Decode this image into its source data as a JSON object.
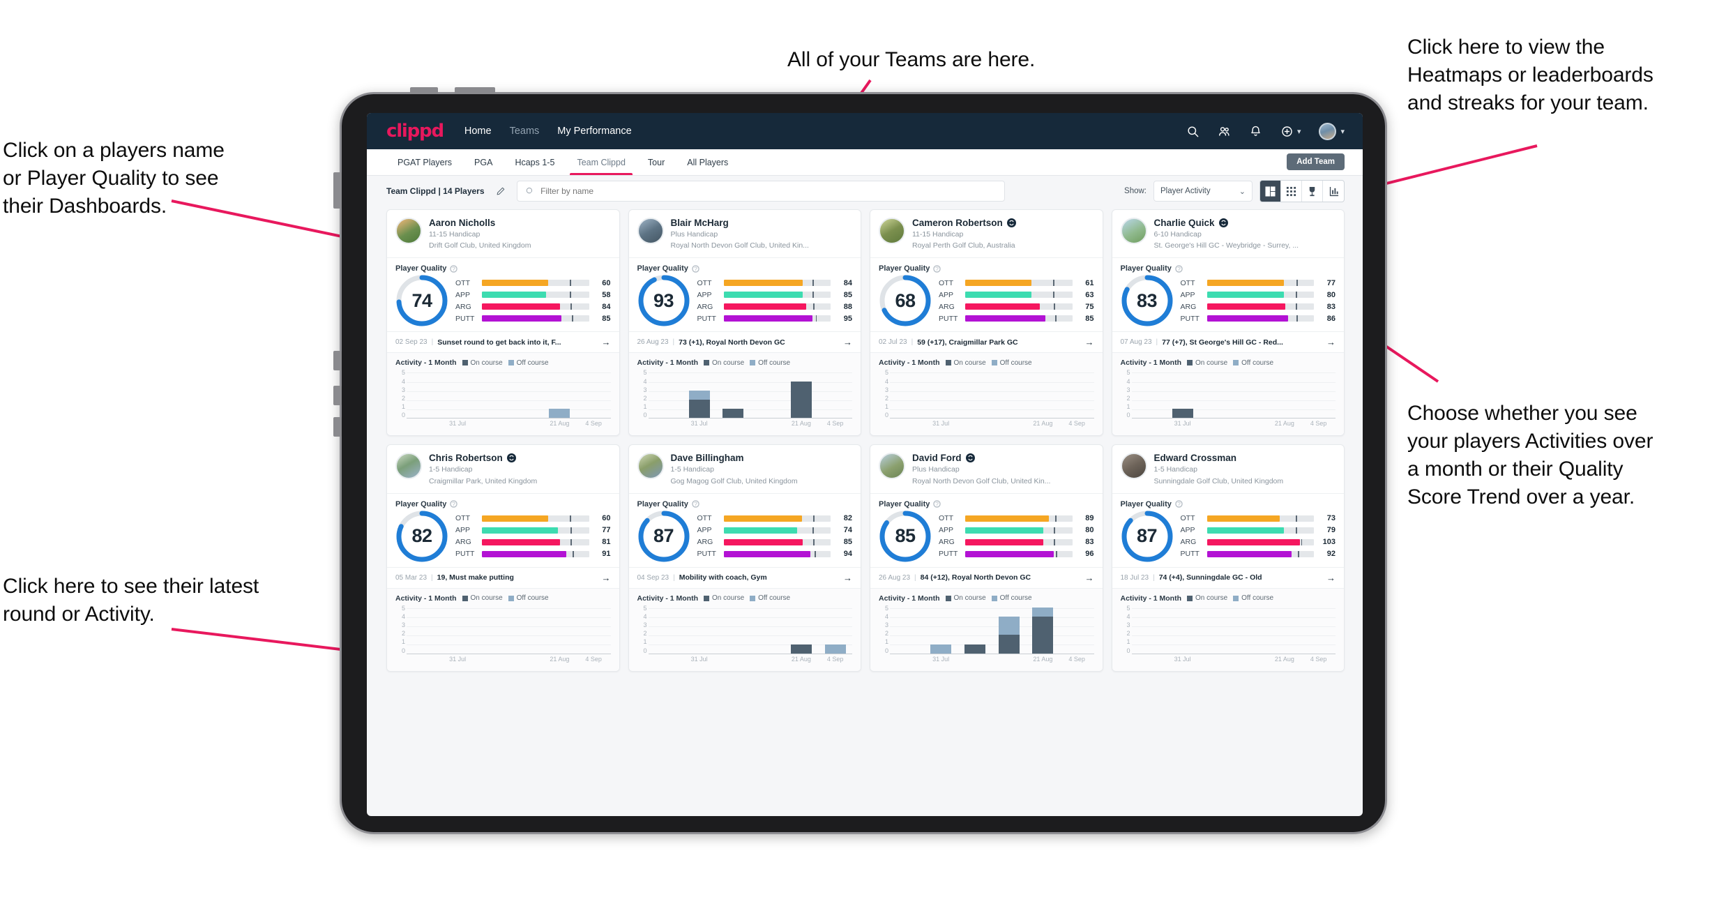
{
  "annotations": [
    {
      "id": "teams-note",
      "text": "All of your Teams are here."
    },
    {
      "id": "heatmaps-note",
      "text": "Click here to view the\nHeatmaps or leaderboards\nand streaks for your team."
    },
    {
      "id": "player-name-note",
      "text": "Click on a players name\nor Player Quality to see\ntheir Dashboards."
    },
    {
      "id": "activity-toggle-note",
      "text": "Choose whether you see\nyour players Activities over\na month or their Quality\nScore Trend over a year."
    },
    {
      "id": "latest-round-note",
      "text": "Click here to see their latest\nround or Activity."
    }
  ],
  "app": {
    "logo": "clippd",
    "nav": [
      {
        "label": "Home",
        "active": true
      },
      {
        "label": "Teams",
        "active": false
      },
      {
        "label": "My Performance",
        "active": true
      }
    ],
    "icons": {
      "search": "search-icon",
      "people": "people-icon",
      "bell": "bell-icon",
      "plus": "plus-circle-icon",
      "avatar": "user-avatar"
    }
  },
  "subnav": {
    "tabs": [
      {
        "label": "PGAT Players",
        "active": false
      },
      {
        "label": "PGA",
        "active": false
      },
      {
        "label": "Hcaps 1-5",
        "active": false
      },
      {
        "label": "Team Clippd",
        "active": true
      },
      {
        "label": "Tour",
        "active": false
      },
      {
        "label": "All Players",
        "active": false
      }
    ],
    "add_team_label": "Add Team"
  },
  "filterbar": {
    "team_label": "Team Clippd | 14 Players",
    "edit_icon": "pencil-icon",
    "search_placeholder": "Filter by name",
    "search_value": "",
    "show_label": "Show:",
    "show_value": "Player Activity",
    "views": [
      {
        "name": "grid-large-view",
        "active": true
      },
      {
        "name": "grid-small-view",
        "active": false
      },
      {
        "name": "trophy-view",
        "active": false
      },
      {
        "name": "streaks-view",
        "active": false
      }
    ]
  },
  "card_labels": {
    "player_quality": "Player Quality",
    "activity_title": "Activity - 1 Month",
    "legend_on": "On course",
    "legend_off": "Off course",
    "round_arrow": "→",
    "metric_names": [
      "OTT",
      "APP",
      "ARG",
      "PUTT"
    ],
    "y_ticks": [
      "5",
      "4",
      "3",
      "2",
      "1",
      "0"
    ],
    "x_ticks": [
      "31 Jul",
      "21 Aug",
      "4 Sep"
    ]
  },
  "colors": {
    "brand_pink": "#e8185d",
    "header_navy": "#16293a",
    "ott": "#f5a623",
    "app": "#3ddcb0",
    "arg": "#f5175f",
    "putt": "#b312d4",
    "ring": "#1f7dd6",
    "ring_track": "#dfe3e7",
    "on_course": "#4f6170",
    "off_course": "#8fadc6"
  },
  "players": [
    {
      "name": "Aaron Nicholls",
      "verified": false,
      "handicap": "11-15 Handicap",
      "club": "Drift Golf Club, United Kingdom",
      "quality": 74,
      "metrics": [
        {
          "label": "OTT",
          "value": 60,
          "fill": 62,
          "tick": 82
        },
        {
          "label": "APP",
          "value": 58,
          "fill": 60,
          "tick": 82
        },
        {
          "label": "ARG",
          "value": 84,
          "fill": 73,
          "tick": 83
        },
        {
          "label": "PUTT",
          "value": 85,
          "fill": 74,
          "tick": 84
        }
      ],
      "round": {
        "date": "02 Sep 23",
        "desc": "Sunset round to get back into it, F..."
      },
      "activity": [
        {
          "on": 0,
          "off": 0
        },
        {
          "on": 0,
          "off": 0
        },
        {
          "on": 0,
          "off": 0
        },
        {
          "on": 0,
          "off": 0
        },
        {
          "on": 0,
          "off": 1
        },
        {
          "on": 0,
          "off": 0
        }
      ]
    },
    {
      "name": "Blair McHarg",
      "verified": false,
      "handicap": "Plus Handicap",
      "club": "Royal North Devon Golf Club, United Kin...",
      "quality": 93,
      "metrics": [
        {
          "label": "OTT",
          "value": 84,
          "fill": 74,
          "tick": 83
        },
        {
          "label": "APP",
          "value": 85,
          "fill": 74,
          "tick": 83
        },
        {
          "label": "ARG",
          "value": 88,
          "fill": 77,
          "tick": 84
        },
        {
          "label": "PUTT",
          "value": 95,
          "fill": 83,
          "tick": 86
        }
      ],
      "round": {
        "date": "26 Aug 23",
        "desc": "73 (+1), Royal North Devon GC"
      },
      "activity": [
        {
          "on": 0,
          "off": 0
        },
        {
          "on": 2,
          "off": 1
        },
        {
          "on": 1,
          "off": 0
        },
        {
          "on": 0,
          "off": 0
        },
        {
          "on": 4,
          "off": 0
        },
        {
          "on": 0,
          "off": 0
        }
      ]
    },
    {
      "name": "Cameron Robertson",
      "verified": true,
      "handicap": "11-15 Handicap",
      "club": "Royal Perth Golf Club, Australia",
      "quality": 68,
      "metrics": [
        {
          "label": "OTT",
          "value": 61,
          "fill": 62,
          "tick": 82
        },
        {
          "label": "APP",
          "value": 63,
          "fill": 62,
          "tick": 82
        },
        {
          "label": "ARG",
          "value": 75,
          "fill": 70,
          "tick": 83
        },
        {
          "label": "PUTT",
          "value": 85,
          "fill": 75,
          "tick": 84
        }
      ],
      "round": {
        "date": "02 Jul 23",
        "desc": "59 (+17), Craigmillar Park GC"
      },
      "activity": [
        {
          "on": 0,
          "off": 0
        },
        {
          "on": 0,
          "off": 0
        },
        {
          "on": 0,
          "off": 0
        },
        {
          "on": 0,
          "off": 0
        },
        {
          "on": 0,
          "off": 0
        },
        {
          "on": 0,
          "off": 0
        }
      ]
    },
    {
      "name": "Charlie Quick",
      "verified": true,
      "handicap": "6-10 Handicap",
      "club": "St. George's Hill GC - Weybridge - Surrey, ...",
      "quality": 83,
      "metrics": [
        {
          "label": "OTT",
          "value": 77,
          "fill": 72,
          "tick": 84
        },
        {
          "label": "APP",
          "value": 80,
          "fill": 72,
          "tick": 83
        },
        {
          "label": "ARG",
          "value": 83,
          "fill": 73,
          "tick": 83
        },
        {
          "label": "PUTT",
          "value": 86,
          "fill": 76,
          "tick": 84
        }
      ],
      "round": {
        "date": "07 Aug 23",
        "desc": "77 (+7), St George's Hill GC - Red..."
      },
      "activity": [
        {
          "on": 0,
          "off": 0
        },
        {
          "on": 1,
          "off": 0
        },
        {
          "on": 0,
          "off": 0
        },
        {
          "on": 0,
          "off": 0
        },
        {
          "on": 0,
          "off": 0
        },
        {
          "on": 0,
          "off": 0
        }
      ]
    },
    {
      "name": "Chris Robertson",
      "verified": true,
      "handicap": "1-5 Handicap",
      "club": "Craigmillar Park, United Kingdom",
      "quality": 82,
      "metrics": [
        {
          "label": "OTT",
          "value": 60,
          "fill": 62,
          "tick": 82
        },
        {
          "label": "APP",
          "value": 77,
          "fill": 71,
          "tick": 83
        },
        {
          "label": "ARG",
          "value": 81,
          "fill": 73,
          "tick": 83
        },
        {
          "label": "PUTT",
          "value": 91,
          "fill": 79,
          "tick": 85
        }
      ],
      "round": {
        "date": "05 Mar 23",
        "desc": "19, Must make putting"
      },
      "activity": [
        {
          "on": 0,
          "off": 0
        },
        {
          "on": 0,
          "off": 0
        },
        {
          "on": 0,
          "off": 0
        },
        {
          "on": 0,
          "off": 0
        },
        {
          "on": 0,
          "off": 0
        },
        {
          "on": 0,
          "off": 0
        }
      ]
    },
    {
      "name": "Dave Billingham",
      "verified": false,
      "handicap": "1-5 Handicap",
      "club": "Gog Magog Golf Club, United Kingdom",
      "quality": 87,
      "metrics": [
        {
          "label": "OTT",
          "value": 82,
          "fill": 73,
          "tick": 84
        },
        {
          "label": "APP",
          "value": 74,
          "fill": 69,
          "tick": 83
        },
        {
          "label": "ARG",
          "value": 85,
          "fill": 74,
          "tick": 84
        },
        {
          "label": "PUTT",
          "value": 94,
          "fill": 81,
          "tick": 85
        }
      ],
      "round": {
        "date": "04 Sep 23",
        "desc": "Mobility with coach, Gym"
      },
      "activity": [
        {
          "on": 0,
          "off": 0
        },
        {
          "on": 0,
          "off": 0
        },
        {
          "on": 0,
          "off": 0
        },
        {
          "on": 0,
          "off": 0
        },
        {
          "on": 1,
          "off": 0
        },
        {
          "on": 0,
          "off": 1
        }
      ]
    },
    {
      "name": "David Ford",
      "verified": true,
      "handicap": "Plus Handicap",
      "club": "Royal North Devon Golf Club, United Kin...",
      "quality": 85,
      "metrics": [
        {
          "label": "OTT",
          "value": 89,
          "fill": 78,
          "tick": 84
        },
        {
          "label": "APP",
          "value": 80,
          "fill": 73,
          "tick": 83
        },
        {
          "label": "ARG",
          "value": 83,
          "fill": 73,
          "tick": 83
        },
        {
          "label": "PUTT",
          "value": 96,
          "fill": 83,
          "tick": 85
        }
      ],
      "round": {
        "date": "26 Aug 23",
        "desc": "84 (+12), Royal North Devon GC"
      },
      "activity": [
        {
          "on": 0,
          "off": 0
        },
        {
          "on": 0,
          "off": 1
        },
        {
          "on": 1,
          "off": 0
        },
        {
          "on": 2,
          "off": 2
        },
        {
          "on": 4,
          "off": 1
        },
        {
          "on": 0,
          "off": 0
        }
      ]
    },
    {
      "name": "Edward Crossman",
      "verified": false,
      "handicap": "1-5 Handicap",
      "club": "Sunningdale Golf Club, United Kingdom",
      "quality": 87,
      "metrics": [
        {
          "label": "OTT",
          "value": 73,
          "fill": 68,
          "tick": 83
        },
        {
          "label": "APP",
          "value": 79,
          "fill": 72,
          "tick": 83
        },
        {
          "label": "ARG",
          "value": 103,
          "fill": 87,
          "tick": 88
        },
        {
          "label": "PUTT",
          "value": 92,
          "fill": 79,
          "tick": 85
        }
      ],
      "round": {
        "date": "18 Jul 23",
        "desc": "74 (+4), Sunningdale GC - Old"
      },
      "activity": [
        {
          "on": 0,
          "off": 0
        },
        {
          "on": 0,
          "off": 0
        },
        {
          "on": 0,
          "off": 0
        },
        {
          "on": 0,
          "off": 0
        },
        {
          "on": 0,
          "off": 0
        },
        {
          "on": 0,
          "off": 0
        }
      ]
    }
  ]
}
